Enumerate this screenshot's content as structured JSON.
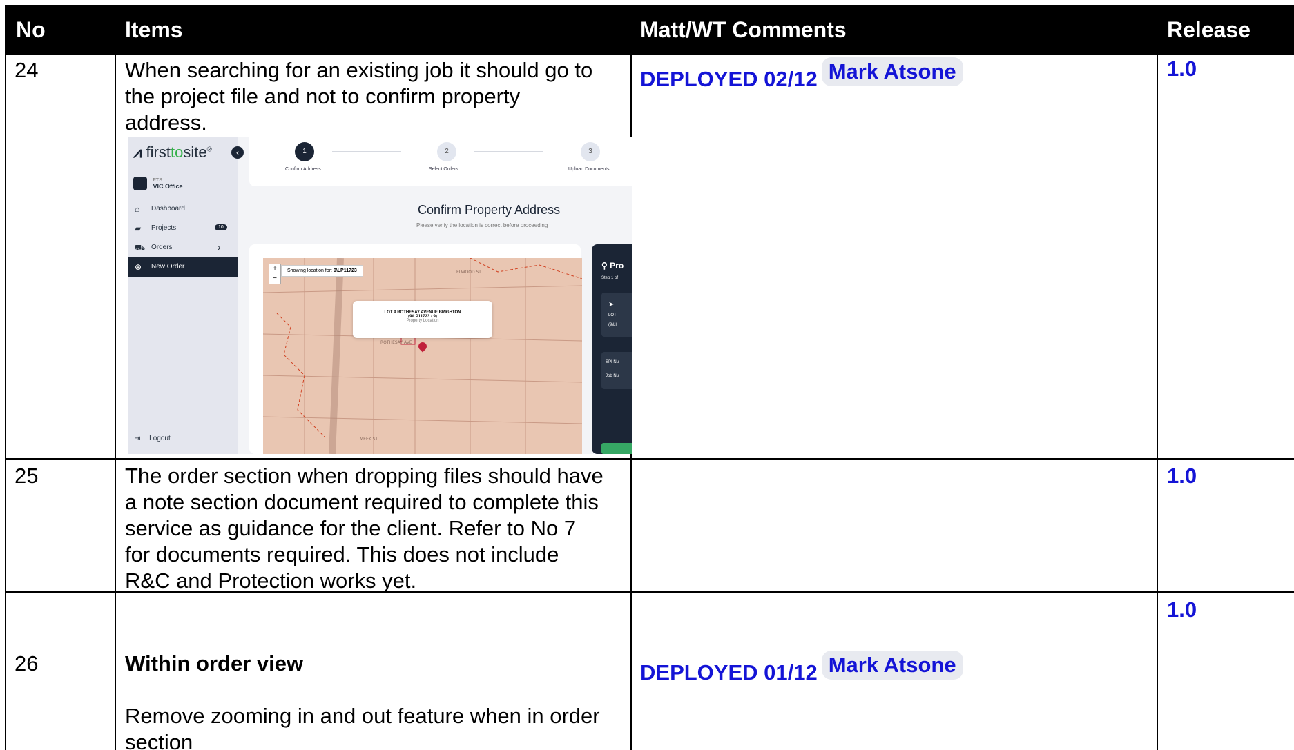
{
  "header": {
    "no": "No",
    "items": "Items",
    "comments": "Matt/WT Comments",
    "release": "Release"
  },
  "rows": [
    {
      "no": "24",
      "item_lines": [
        "When searching for an existing job it should go to",
        "the project file and not to confirm property",
        "address."
      ],
      "comment_status": "DEPLOYED 02/12",
      "comment_person": "Mark Atsone",
      "release": "1.0"
    },
    {
      "no": "25",
      "item_lines": [
        "The order section when dropping files should have",
        "a note section document required to complete this",
        "service as guidance for the client. Refer to No 7",
        "for documents required. This does not include",
        "R&C and Protection works yet."
      ],
      "release": "1.0"
    },
    {
      "no": "26",
      "item_heading": "Within order view",
      "item_lines": [
        "Remove zooming in and out feature when in order",
        "section"
      ],
      "comment_status": "DEPLOYED 01/12",
      "comment_person": "Mark Atsone",
      "release": "1.0"
    }
  ],
  "screenshot": {
    "logo_part1": "first",
    "logo_part2": "to",
    "logo_part3": "site",
    "logo_mark": "®",
    "office_label": "FTS",
    "office_name": "VIC Office",
    "nav": [
      {
        "label": "Dashboard",
        "icon": "home-icon"
      },
      {
        "label": "Projects",
        "icon": "folder-icon",
        "badge": "10"
      },
      {
        "label": "Orders",
        "icon": "cart-icon"
      },
      {
        "label": "New Order",
        "icon": "plus-circle-icon",
        "active": true
      }
    ],
    "logout": "Logout",
    "steps": [
      {
        "num": "1",
        "label": "Confirm Address"
      },
      {
        "num": "2",
        "label": "Select Orders"
      },
      {
        "num": "3",
        "label": "Upload Documents"
      }
    ],
    "confirm_title": "Confirm Property Address",
    "confirm_sub": "Please verify the location is correct before proceeding",
    "showing_label": "Showing location for:",
    "showing_value": "9\\LP11723",
    "popup_line1": "LOT 9 ROTHESAY AVENUE BRIGHTON",
    "popup_line2": "(9\\LP11723 - 9)",
    "popup_line3": "Property Location",
    "side_title": "Pro",
    "side_step": "Step 1 of",
    "side_lot": "LOT",
    "side_lot2": "(9\\LI",
    "side_spi": "SPI Nu",
    "side_job": "Job Nu",
    "streets": [
      "ELWOOD ST",
      "ROTHESAY AVE",
      "MEEK ST"
    ]
  },
  "colors": {
    "header_bg": "#000000",
    "accent_blue": "#1414d6",
    "chip_bg": "#e8eaf0",
    "app_dark": "#1b2535",
    "brand_green": "#35b04a",
    "map_bg": "#e9c6b2",
    "pin": "#c0213a"
  }
}
